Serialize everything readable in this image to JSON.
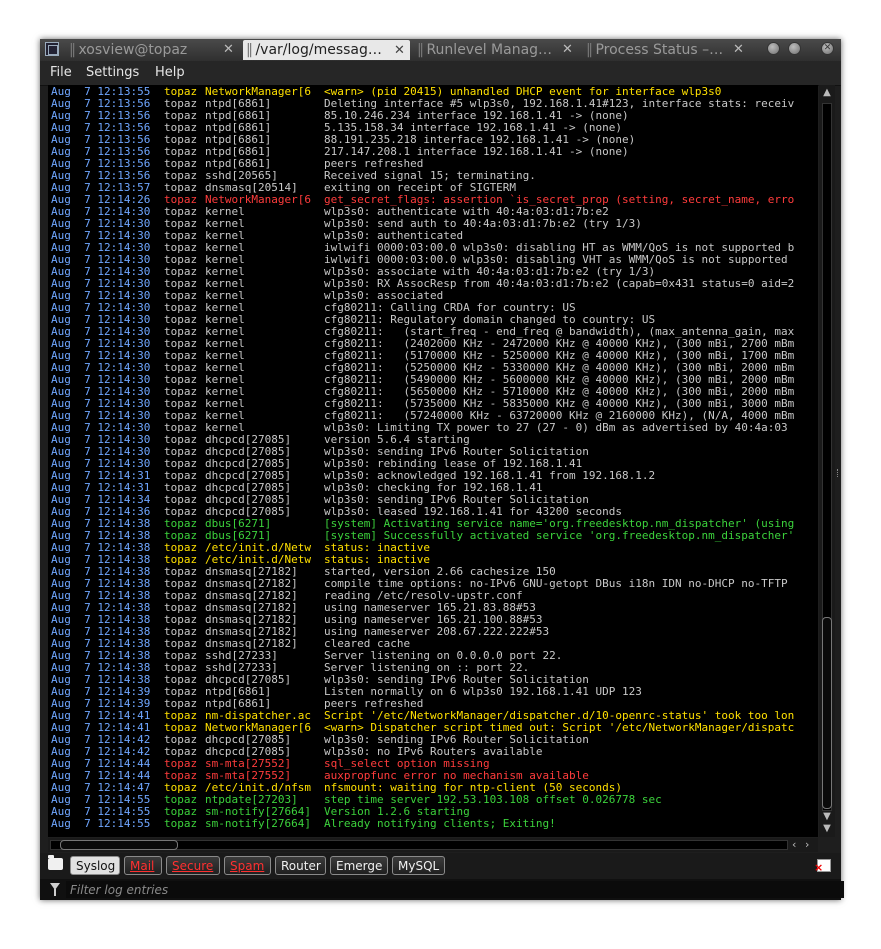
{
  "tabs": [
    {
      "label": "xosview@topaz",
      "active": false
    },
    {
      "label": "/var/log/messag…",
      "active": true
    },
    {
      "label": "Runlevel Manag…",
      "active": false
    },
    {
      "label": "Process Status –…",
      "active": false
    }
  ],
  "menu": {
    "file": "File",
    "settings": "Settings",
    "help": "Help"
  },
  "log_rows": [
    {
      "t": "w",
      "date": "Aug  7 12:13:55",
      "host": "topaz",
      "proc": "NetworkManager[6",
      "msg": "<warn> (pid 20415) unhandled DHCP event for interface wlp3s0"
    },
    {
      "t": "n",
      "date": "Aug  7 12:13:56",
      "host": "topaz",
      "proc": "ntpd[6861]",
      "msg": "Deleting interface #5 wlp3s0, 192.168.1.41#123, interface stats: receiv"
    },
    {
      "t": "n",
      "date": "Aug  7 12:13:56",
      "host": "topaz",
      "proc": "ntpd[6861]",
      "msg": "85.10.246.234 interface 192.168.1.41 -> (none)"
    },
    {
      "t": "n",
      "date": "Aug  7 12:13:56",
      "host": "topaz",
      "proc": "ntpd[6861]",
      "msg": "5.135.158.34 interface 192.168.1.41 -> (none)"
    },
    {
      "t": "n",
      "date": "Aug  7 12:13:56",
      "host": "topaz",
      "proc": "ntpd[6861]",
      "msg": "88.191.235.218 interface 192.168.1.41 -> (none)"
    },
    {
      "t": "n",
      "date": "Aug  7 12:13:56",
      "host": "topaz",
      "proc": "ntpd[6861]",
      "msg": "217.147.208.1 interface 192.168.1.41 -> (none)"
    },
    {
      "t": "n",
      "date": "Aug  7 12:13:56",
      "host": "topaz",
      "proc": "ntpd[6861]",
      "msg": "peers refreshed"
    },
    {
      "t": "n",
      "date": "Aug  7 12:13:56",
      "host": "topaz",
      "proc": "sshd[20565]",
      "msg": "Received signal 15; terminating."
    },
    {
      "t": "n",
      "date": "Aug  7 12:13:57",
      "host": "topaz",
      "proc": "dnsmasq[20514]",
      "msg": "exiting on receipt of SIGTERM"
    },
    {
      "t": "e",
      "date": "Aug  7 12:14:26",
      "host": "topaz",
      "proc": "NetworkManager[6",
      "msg": "get_secret_flags: assertion `is_secret_prop (setting, secret_name, erro"
    },
    {
      "t": "n",
      "date": "Aug  7 12:14:30",
      "host": "topaz",
      "proc": "kernel",
      "msg": "wlp3s0: authenticate with 40:4a:03:d1:7b:e2"
    },
    {
      "t": "n",
      "date": "Aug  7 12:14:30",
      "host": "topaz",
      "proc": "kernel",
      "msg": "wlp3s0: send auth to 40:4a:03:d1:7b:e2 (try 1/3)"
    },
    {
      "t": "n",
      "date": "Aug  7 12:14:30",
      "host": "topaz",
      "proc": "kernel",
      "msg": "wlp3s0: authenticated"
    },
    {
      "t": "n",
      "date": "Aug  7 12:14:30",
      "host": "topaz",
      "proc": "kernel",
      "msg": "iwlwifi 0000:03:00.0 wlp3s0: disabling HT as WMM/QoS is not supported b"
    },
    {
      "t": "n",
      "date": "Aug  7 12:14:30",
      "host": "topaz",
      "proc": "kernel",
      "msg": "iwlwifi 0000:03:00.0 wlp3s0: disabling VHT as WMM/QoS is not supported"
    },
    {
      "t": "n",
      "date": "Aug  7 12:14:30",
      "host": "topaz",
      "proc": "kernel",
      "msg": "wlp3s0: associate with 40:4a:03:d1:7b:e2 (try 1/3)"
    },
    {
      "t": "n",
      "date": "Aug  7 12:14:30",
      "host": "topaz",
      "proc": "kernel",
      "msg": "wlp3s0: RX AssocResp from 40:4a:03:d1:7b:e2 (capab=0x431 status=0 aid=2"
    },
    {
      "t": "n",
      "date": "Aug  7 12:14:30",
      "host": "topaz",
      "proc": "kernel",
      "msg": "wlp3s0: associated"
    },
    {
      "t": "n",
      "date": "Aug  7 12:14:30",
      "host": "topaz",
      "proc": "kernel",
      "msg": "cfg80211: Calling CRDA for country: US"
    },
    {
      "t": "n",
      "date": "Aug  7 12:14:30",
      "host": "topaz",
      "proc": "kernel",
      "msg": "cfg80211: Regulatory domain changed to country: US"
    },
    {
      "t": "n",
      "date": "Aug  7 12:14:30",
      "host": "topaz",
      "proc": "kernel",
      "msg": "cfg80211:   (start_freq - end_freq @ bandwidth), (max_antenna_gain, max"
    },
    {
      "t": "n",
      "date": "Aug  7 12:14:30",
      "host": "topaz",
      "proc": "kernel",
      "msg": "cfg80211:   (2402000 KHz - 2472000 KHz @ 40000 KHz), (300 mBi, 2700 mBm"
    },
    {
      "t": "n",
      "date": "Aug  7 12:14:30",
      "host": "topaz",
      "proc": "kernel",
      "msg": "cfg80211:   (5170000 KHz - 5250000 KHz @ 40000 KHz), (300 mBi, 1700 mBm"
    },
    {
      "t": "n",
      "date": "Aug  7 12:14:30",
      "host": "topaz",
      "proc": "kernel",
      "msg": "cfg80211:   (5250000 KHz - 5330000 KHz @ 40000 KHz), (300 mBi, 2000 mBm"
    },
    {
      "t": "n",
      "date": "Aug  7 12:14:30",
      "host": "topaz",
      "proc": "kernel",
      "msg": "cfg80211:   (5490000 KHz - 5600000 KHz @ 40000 KHz), (300 mBi, 2000 mBm"
    },
    {
      "t": "n",
      "date": "Aug  7 12:14:30",
      "host": "topaz",
      "proc": "kernel",
      "msg": "cfg80211:   (5650000 KHz - 5710000 KHz @ 40000 KHz), (300 mBi, 2000 mBm"
    },
    {
      "t": "n",
      "date": "Aug  7 12:14:30",
      "host": "topaz",
      "proc": "kernel",
      "msg": "cfg80211:   (5735000 KHz - 5835000 KHz @ 40000 KHz), (300 mBi, 3000 mBm"
    },
    {
      "t": "n",
      "date": "Aug  7 12:14:30",
      "host": "topaz",
      "proc": "kernel",
      "msg": "cfg80211:   (57240000 KHz - 63720000 KHz @ 2160000 KHz), (N/A, 4000 mBm"
    },
    {
      "t": "n",
      "date": "Aug  7 12:14:30",
      "host": "topaz",
      "proc": "kernel",
      "msg": "wlp3s0: Limiting TX power to 27 (27 - 0) dBm as advertised by 40:4a:03"
    },
    {
      "t": "n",
      "date": "Aug  7 12:14:30",
      "host": "topaz",
      "proc": "dhcpcd[27085]",
      "msg": "version 5.6.4 starting"
    },
    {
      "t": "n",
      "date": "Aug  7 12:14:30",
      "host": "topaz",
      "proc": "dhcpcd[27085]",
      "msg": "wlp3s0: sending IPv6 Router Solicitation"
    },
    {
      "t": "n",
      "date": "Aug  7 12:14:30",
      "host": "topaz",
      "proc": "dhcpcd[27085]",
      "msg": "wlp3s0: rebinding lease of 192.168.1.41"
    },
    {
      "t": "n",
      "date": "Aug  7 12:14:31",
      "host": "topaz",
      "proc": "dhcpcd[27085]",
      "msg": "wlp3s0: acknowledged 192.168.1.41 from 192.168.1.2"
    },
    {
      "t": "n",
      "date": "Aug  7 12:14:31",
      "host": "topaz",
      "proc": "dhcpcd[27085]",
      "msg": "wlp3s0: checking for 192.168.1.41"
    },
    {
      "t": "n",
      "date": "Aug  7 12:14:34",
      "host": "topaz",
      "proc": "dhcpcd[27085]",
      "msg": "wlp3s0: sending IPv6 Router Solicitation"
    },
    {
      "t": "n",
      "date": "Aug  7 12:14:36",
      "host": "topaz",
      "proc": "dhcpcd[27085]",
      "msg": "wlp3s0: leased 192.168.1.41 for 43200 seconds"
    },
    {
      "t": "g",
      "date": "Aug  7 12:14:38",
      "host": "topaz",
      "proc": "dbus[6271]",
      "msg": "[system] Activating service name='org.freedesktop.nm_dispatcher' (using"
    },
    {
      "t": "g",
      "date": "Aug  7 12:14:38",
      "host": "topaz",
      "proc": "dbus[6271]",
      "msg": "[system] Successfully activated service 'org.freedesktop.nm_dispatcher'"
    },
    {
      "t": "w",
      "date": "Aug  7 12:14:38",
      "host": "topaz",
      "proc": "/etc/init.d/Netw",
      "msg": "status: inactive"
    },
    {
      "t": "w",
      "date": "Aug  7 12:14:38",
      "host": "topaz",
      "proc": "/etc/init.d/Netw",
      "msg": "status: inactive"
    },
    {
      "t": "n",
      "date": "Aug  7 12:14:38",
      "host": "topaz",
      "proc": "dnsmasq[27182]",
      "msg": "started, version 2.66 cachesize 150"
    },
    {
      "t": "n",
      "date": "Aug  7 12:14:38",
      "host": "topaz",
      "proc": "dnsmasq[27182]",
      "msg": "compile time options: no-IPv6 GNU-getopt DBus i18n IDN no-DHCP no-TFTP"
    },
    {
      "t": "n",
      "date": "Aug  7 12:14:38",
      "host": "topaz",
      "proc": "dnsmasq[27182]",
      "msg": "reading /etc/resolv-upstr.conf"
    },
    {
      "t": "n",
      "date": "Aug  7 12:14:38",
      "host": "topaz",
      "proc": "dnsmasq[27182]",
      "msg": "using nameserver 165.21.83.88#53"
    },
    {
      "t": "n",
      "date": "Aug  7 12:14:38",
      "host": "topaz",
      "proc": "dnsmasq[27182]",
      "msg": "using nameserver 165.21.100.88#53"
    },
    {
      "t": "n",
      "date": "Aug  7 12:14:38",
      "host": "topaz",
      "proc": "dnsmasq[27182]",
      "msg": "using nameserver 208.67.222.222#53"
    },
    {
      "t": "n",
      "date": "Aug  7 12:14:38",
      "host": "topaz",
      "proc": "dnsmasq[27182]",
      "msg": "cleared cache"
    },
    {
      "t": "n",
      "date": "Aug  7 12:14:38",
      "host": "topaz",
      "proc": "sshd[27233]",
      "msg": "Server listening on 0.0.0.0 port 22."
    },
    {
      "t": "n",
      "date": "Aug  7 12:14:38",
      "host": "topaz",
      "proc": "sshd[27233]",
      "msg": "Server listening on :: port 22."
    },
    {
      "t": "n",
      "date": "Aug  7 12:14:38",
      "host": "topaz",
      "proc": "dhcpcd[27085]",
      "msg": "wlp3s0: sending IPv6 Router Solicitation"
    },
    {
      "t": "n",
      "date": "Aug  7 12:14:39",
      "host": "topaz",
      "proc": "ntpd[6861]",
      "msg": "Listen normally on 6 wlp3s0 192.168.1.41 UDP 123"
    },
    {
      "t": "n",
      "date": "Aug  7 12:14:39",
      "host": "topaz",
      "proc": "ntpd[6861]",
      "msg": "peers refreshed"
    },
    {
      "t": "w",
      "date": "Aug  7 12:14:41",
      "host": "topaz",
      "proc": "nm-dispatcher.ac",
      "msg": "Script '/etc/NetworkManager/dispatcher.d/10-openrc-status' took too lon"
    },
    {
      "t": "w",
      "date": "Aug  7 12:14:41",
      "host": "topaz",
      "proc": "NetworkManager[6",
      "msg": "<warn> Dispatcher script timed out: Script '/etc/NetworkManager/dispatc"
    },
    {
      "t": "n",
      "date": "Aug  7 12:14:42",
      "host": "topaz",
      "proc": "dhcpcd[27085]",
      "msg": "wlp3s0: sending IPv6 Router Solicitation"
    },
    {
      "t": "n",
      "date": "Aug  7 12:14:42",
      "host": "topaz",
      "proc": "dhcpcd[27085]",
      "msg": "wlp3s0: no IPv6 Routers available"
    },
    {
      "t": "e",
      "date": "Aug  7 12:14:44",
      "host": "topaz",
      "proc": "sm-mta[27552]",
      "msg": "sql_select option missing"
    },
    {
      "t": "e",
      "date": "Aug  7 12:14:44",
      "host": "topaz",
      "proc": "sm-mta[27552]",
      "msg": "auxpropfunc error no mechanism available"
    },
    {
      "t": "w",
      "date": "Aug  7 12:14:47",
      "host": "topaz",
      "proc": "/etc/init.d/nfsm",
      "msg": "nfsmount: waiting for ntp-client (50 seconds)"
    },
    {
      "t": "g",
      "date": "Aug  7 12:14:55",
      "host": "topaz",
      "proc": "ntpdate[27203]",
      "msg": "step time server 192.53.103.108 offset 0.026778 sec"
    },
    {
      "t": "g",
      "date": "Aug  7 12:14:55",
      "host": "topaz",
      "proc": "sm-notify[27664]",
      "msg": "Version 1.2.6 starting"
    },
    {
      "t": "g",
      "date": "Aug  7 12:14:55",
      "host": "topaz",
      "proc": "sm-notify[27664]",
      "msg": "Already notifying clients; Exiting!"
    }
  ],
  "filter_tabs": [
    {
      "label": "Syslog",
      "active": true,
      "alert": false
    },
    {
      "label": "Mail",
      "active": false,
      "alert": true
    },
    {
      "label": "Secure",
      "active": false,
      "alert": true
    },
    {
      "label": "Spam",
      "active": false,
      "alert": true
    },
    {
      "label": "Router",
      "active": false,
      "alert": false
    },
    {
      "label": "Emerge",
      "active": false,
      "alert": false
    },
    {
      "label": "MySQL",
      "active": false,
      "alert": false
    }
  ],
  "filter": {
    "placeholder": "Filter log entries",
    "value": ""
  },
  "colors": {
    "date": "#6fa6ff",
    "normal": "#c8c8c8",
    "warning": "#ffe000",
    "error": "#ff3c3c",
    "info": "#3cd23c"
  }
}
